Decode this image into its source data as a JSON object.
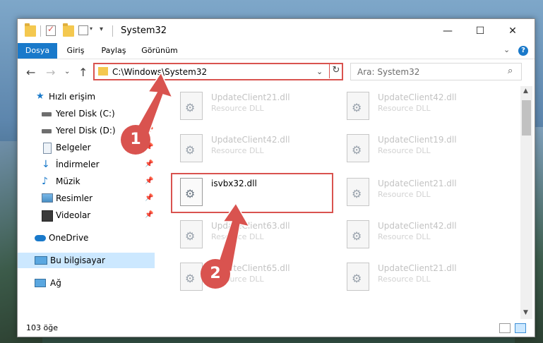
{
  "window": {
    "title": "System32",
    "controls": {
      "minimize": "—",
      "maximize": "☐",
      "close": "✕"
    }
  },
  "ribbon": {
    "tabs": [
      "Dosya",
      "Giriş",
      "Paylaş",
      "Görünüm"
    ],
    "help": "?"
  },
  "address": {
    "path": "C:\\Windows\\System32",
    "search_placeholder": "Ara: System32"
  },
  "nav": {
    "quick_access": "Hızlı erişim",
    "items": [
      "Yerel Disk (C:)",
      "Yerel Disk (D:)",
      "Belgeler",
      "İndirmeler",
      "Müzik",
      "Resimler",
      "Videolar"
    ],
    "onedrive": "OneDrive",
    "this_pc": "Bu bilgisayar",
    "network": "Ağ"
  },
  "files": [
    {
      "name": "UpdateClient21.dll",
      "type": "Resource DLL"
    },
    {
      "name": "UpdateClient42.dll",
      "type": "Resource DLL"
    },
    {
      "name": "UpdateClient42.dll",
      "type": "Resource DLL"
    },
    {
      "name": "UpdateClient19.dll",
      "type": "Resource DLL"
    },
    {
      "name": "isvbx32.dll",
      "type": ""
    },
    {
      "name": "UpdateClient21.dll",
      "type": "Resource DLL"
    },
    {
      "name": "UpdateClient63.dll",
      "type": "Resource DLL"
    },
    {
      "name": "UpdateClient42.dll",
      "type": "Resource DLL"
    },
    {
      "name": "UpdateClient65.dll",
      "type": "Resource DLL"
    },
    {
      "name": "UpdateClient21.dll",
      "type": "Resource DLL"
    }
  ],
  "callouts": [
    "1",
    "2"
  ],
  "status": {
    "count": "103 öğe"
  },
  "colors": {
    "accent": "#1979ca",
    "highlight": "#d9534f",
    "selection": "#cce8ff"
  }
}
